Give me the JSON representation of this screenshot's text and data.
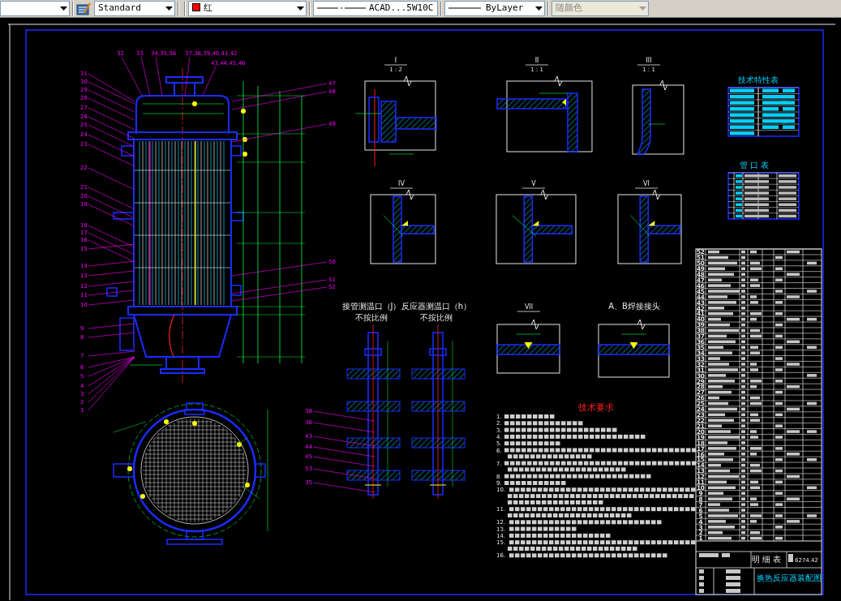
{
  "toolbar": {
    "text_style": "Standard",
    "color": {
      "label": "红",
      "color": "#ff0000"
    },
    "linetype": "ACAD...5W10C",
    "lineweight": "ByLayer",
    "plot_style": {
      "label": "随颜色",
      "disabled": true
    }
  },
  "assembly_view": {
    "part_labels": [
      "32",
      "33",
      "34,35,36",
      "37,38,39,40,41,42",
      "43,44,45,46",
      "31",
      "30",
      "29",
      "28",
      "27",
      "26",
      "25",
      "24",
      "23",
      "22",
      "21",
      "20",
      "19",
      "18",
      "17",
      "16",
      "15",
      "14",
      "13",
      "12",
      "11",
      "10",
      "9",
      "8",
      "7",
      "6",
      "5",
      "4",
      "3",
      "2",
      "1",
      "47",
      "48",
      "49",
      "50",
      "51",
      "52"
    ]
  },
  "detail_views": [
    {
      "label": "I",
      "scale": "1 : 2"
    },
    {
      "label": "II",
      "scale": "1 : 1"
    },
    {
      "label": "III",
      "scale": "1 : 1"
    },
    {
      "label": "IV"
    },
    {
      "label": "V"
    },
    {
      "label": "VI"
    },
    {
      "label": "VII"
    },
    {
      "label": "A、B焊接接头"
    }
  ],
  "nozzle_sections": {
    "views": [
      {
        "title": "接管测温口（J）",
        "note": "不按比例"
      },
      {
        "title": "反应器测温口（h）",
        "note": "不按比例"
      }
    ],
    "part_labels": [
      "38",
      "36",
      "43",
      "44",
      "45",
      "53",
      "35"
    ]
  },
  "technical_requirements": {
    "title": "技术要求",
    "items": [
      "1.",
      "2.",
      "3.",
      "4.",
      "5.",
      "6.",
      "7.",
      "8.",
      "9.",
      "10.",
      "11.",
      "12.",
      "13.",
      "14.",
      "15.",
      "16."
    ]
  },
  "tech_spec_table": {
    "title": "技术特性表"
  },
  "nozzle_table": {
    "title": "管 口 表"
  },
  "parts_list": {
    "numbers": [
      "52",
      "51",
      "50",
      "49",
      "48",
      "47",
      "46",
      "45",
      "44",
      "43",
      "42",
      "41",
      "40",
      "39",
      "38",
      "37",
      "36",
      "35",
      "34",
      "33",
      "32",
      "31",
      "30",
      "29",
      "28",
      "27",
      "26",
      "25",
      "24",
      "23",
      "22",
      "21",
      "20",
      "19",
      "18",
      "17",
      "16",
      "15",
      "14",
      "13",
      "12",
      "11",
      "10",
      "9",
      "8",
      "7",
      "6",
      "5",
      "4",
      "3",
      "2",
      "1"
    ]
  },
  "title_block": {
    "list_title": "明 细 表",
    "weight": "6274.42",
    "drawing_title": "换热反应器装配图"
  }
}
